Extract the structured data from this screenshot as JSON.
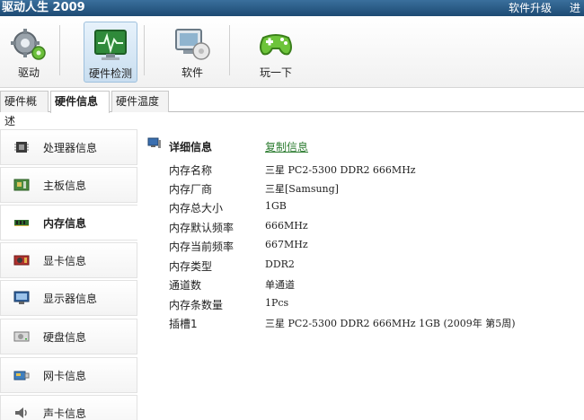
{
  "window": {
    "title": "驱动人生 2009",
    "upgrade_label": "软件升级",
    "more_label": "进"
  },
  "toolbar": {
    "items": [
      {
        "label": "驱动",
        "icon": "gear-icon"
      },
      {
        "label": "硬件检测",
        "icon": "monitor-pulse-icon"
      },
      {
        "label": "软件",
        "icon": "computer-disc-icon"
      },
      {
        "label": "玩一下",
        "icon": "gamepad-icon"
      }
    ]
  },
  "tabs": [
    {
      "label": "硬件概述"
    },
    {
      "label": "硬件信息"
    },
    {
      "label": "硬件温度"
    }
  ],
  "sidebar": {
    "items": [
      {
        "label": "处理器信息",
        "icon": "cpu-icon"
      },
      {
        "label": "主板信息",
        "icon": "motherboard-icon"
      },
      {
        "label": "内存信息",
        "icon": "memory-icon"
      },
      {
        "label": "显卡信息",
        "icon": "graphics-card-icon"
      },
      {
        "label": "显示器信息",
        "icon": "monitor-icon"
      },
      {
        "label": "硬盘信息",
        "icon": "hard-disk-icon"
      },
      {
        "label": "网卡信息",
        "icon": "network-card-icon"
      },
      {
        "label": "声卡信息",
        "icon": "speaker-icon"
      }
    ]
  },
  "details": {
    "title": "详细信息",
    "copy_label": "复制信息",
    "rows": [
      {
        "key": "内存名称",
        "value": "三星 PC2-5300 DDR2 666MHz"
      },
      {
        "key": "内存厂商",
        "value": "三星[Samsung]"
      },
      {
        "key": "内存总大小",
        "value": "1GB"
      },
      {
        "key": "内存默认频率",
        "value": "666MHz"
      },
      {
        "key": "内存当前频率",
        "value": "667MHz"
      },
      {
        "key": "内存类型",
        "value": "DDR2"
      },
      {
        "key": "通道数",
        "value": "单通道"
      },
      {
        "key": "内存条数量",
        "value": "1Pcs"
      },
      {
        "key": "插槽1",
        "value": "三星 PC2-5300 DDR2 666MHz 1GB  (2009年 第5周)"
      }
    ]
  }
}
